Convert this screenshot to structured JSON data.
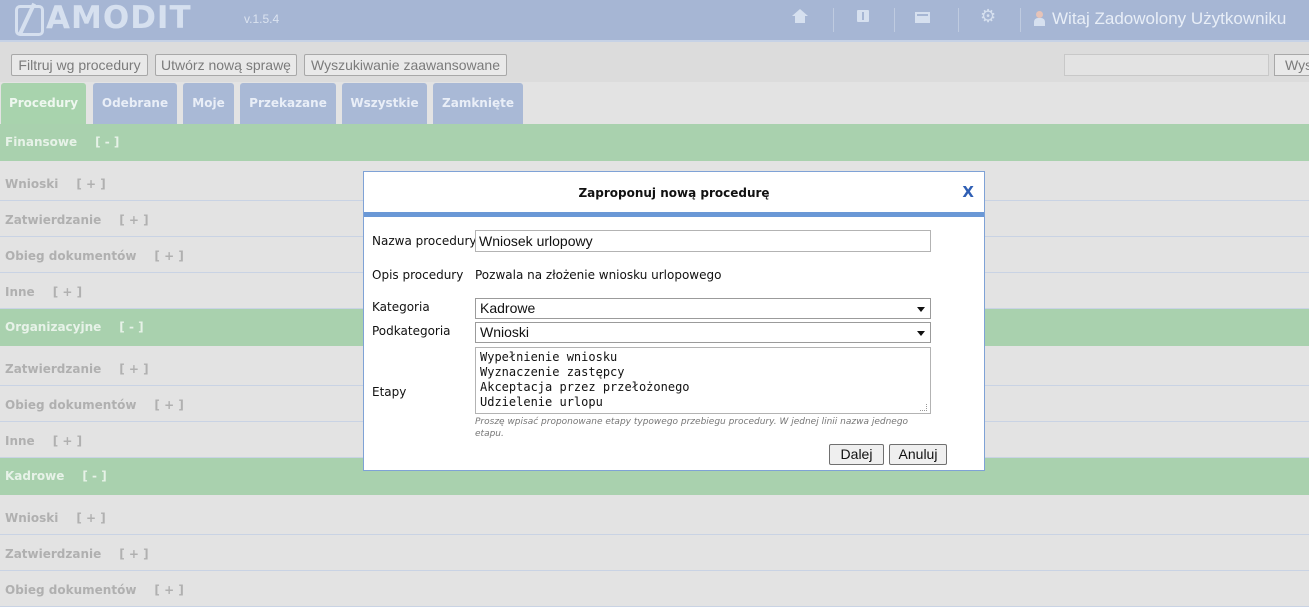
{
  "header": {
    "logo_text": "AMODIT",
    "version": "v.1.5.4",
    "greeting": "Witaj Zadowolony Użytkowniku"
  },
  "toolbar": {
    "filter_label": "Filtruj wg procedury",
    "new_case_label": "Utwórz nową sprawę",
    "advanced_search_label": "Wyszukiwanie zaawansowane",
    "search_value": "",
    "search_button_label": "Wys"
  },
  "tabs": [
    {
      "label": "Procedury",
      "active": true
    },
    {
      "label": "Odebrane",
      "active": false
    },
    {
      "label": "Moje",
      "active": false
    },
    {
      "label": "Przekazane",
      "active": false
    },
    {
      "label": "Wszystkie",
      "active": false
    },
    {
      "label": "Zamknięte",
      "active": false
    }
  ],
  "procedure_list": {
    "categories": [
      {
        "name": "Finansowe",
        "toggle": "[ - ]",
        "subcategories": [
          {
            "name": "Wnioski",
            "toggle": "[ + ]"
          },
          {
            "name": "Zatwierdzanie",
            "toggle": "[ + ]"
          },
          {
            "name": "Obieg dokumentów",
            "toggle": "[ + ]"
          },
          {
            "name": "Inne",
            "toggle": "[ + ]"
          }
        ]
      },
      {
        "name": "Organizacyjne",
        "toggle": "[ - ]",
        "subcategories": [
          {
            "name": "Zatwierdzanie",
            "toggle": "[ + ]"
          },
          {
            "name": "Obieg dokumentów",
            "toggle": "[ + ]"
          },
          {
            "name": "Inne",
            "toggle": "[ + ]"
          }
        ]
      },
      {
        "name": "Kadrowe",
        "toggle": "[ - ]",
        "subcategories": [
          {
            "name": "Wnioski",
            "toggle": "[ + ]"
          },
          {
            "name": "Zatwierdzanie",
            "toggle": "[ + ]"
          },
          {
            "name": "Obieg dokumentów",
            "toggle": "[ + ]"
          }
        ]
      }
    ]
  },
  "modal": {
    "title": "Zaproponuj nową procedurę",
    "close_label": "X",
    "fields": {
      "name_label": "Nazwa procedury",
      "name_value": "Wniosek urlopowy",
      "description_label": "Opis procedury",
      "description_value": "Pozwala na złożenie wniosku urlopowego",
      "category_label": "Kategoria",
      "category_value": "Kadrowe",
      "subcategory_label": "Podkategoria",
      "subcategory_value": "Wnioski",
      "stages_label": "Etapy",
      "stages": [
        "Wypełnienie wniosku",
        "Wyznaczenie zastępcy",
        "Akceptacja przez przełożonego",
        "Udzielenie urlopu"
      ],
      "stages_hint": "Proszę wpisać proponowane etapy typowego przebiegu procedury. W jednej linii nazwa jednego etapu."
    },
    "next_label": "Dalej",
    "cancel_label": "Anuluj"
  },
  "colors": {
    "header_bg": "#a6b6d4",
    "tab_bg": "#a9b9d6",
    "active_tab_bg": "#a8d3ad",
    "category_row_bg": "#a9d1ae",
    "modal_accent": "#6a98d6"
  }
}
